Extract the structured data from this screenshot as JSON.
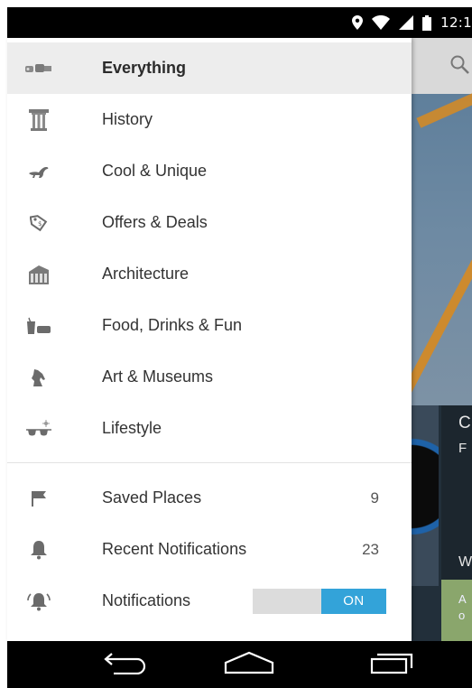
{
  "status_bar": {
    "time": "12:1",
    "icons": [
      "location-icon",
      "wifi-icon",
      "cell-signal-icon",
      "battery-icon"
    ]
  },
  "drawer": {
    "categories": [
      {
        "label": "Everything",
        "icon": "binoculars-icon",
        "selected": true
      },
      {
        "label": "History",
        "icon": "column-icon",
        "selected": false
      },
      {
        "label": "Cool & Unique",
        "icon": "dinosaur-icon",
        "selected": false
      },
      {
        "label": "Offers & Deals",
        "icon": "tag-icon",
        "selected": false
      },
      {
        "label": "Architecture",
        "icon": "building-icon",
        "selected": false
      },
      {
        "label": "Food, Drinks & Fun",
        "icon": "food-drink-icon",
        "selected": false
      },
      {
        "label": "Art & Museums",
        "icon": "horse-head-icon",
        "selected": false
      },
      {
        "label": "Lifestyle",
        "icon": "sunglasses-icon",
        "selected": false
      }
    ],
    "saved_places": {
      "label": "Saved Places",
      "count": "9",
      "icon": "flag-icon"
    },
    "recent_notifications": {
      "label": "Recent Notifications",
      "count": "23",
      "icon": "bell-icon"
    },
    "notifications": {
      "label": "Notifications",
      "toggle_label": "ON",
      "icon": "ringing-bell-icon",
      "enabled": true
    }
  },
  "backdrop": {
    "card_title_fragment": "C",
    "card_sub_fragment": "F",
    "card_bottom_fragment": "W",
    "green_fragment_1": "A",
    "green_fragment_2": "o"
  },
  "nav_bar": {
    "icons": [
      "back-icon",
      "home-icon",
      "recents-icon"
    ]
  },
  "colors": {
    "accent": "#33a3d9",
    "selected_row": "#ededed",
    "icon_gray": "#6b6b6b"
  }
}
